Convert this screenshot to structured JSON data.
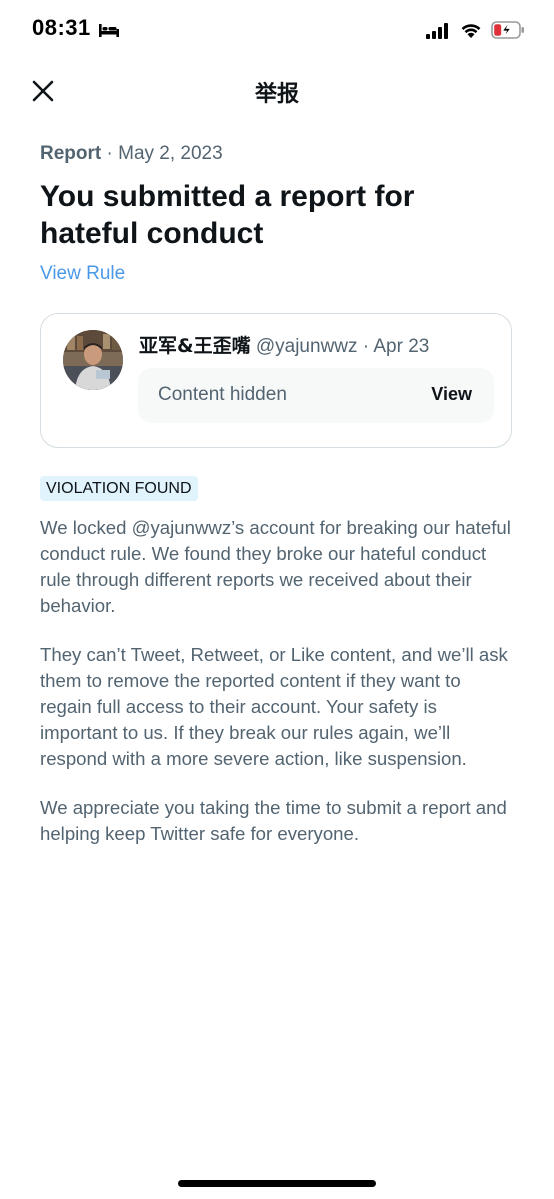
{
  "status_bar": {
    "time": "08:31",
    "icons": [
      "bed-icon",
      "cellular-signal-icon",
      "wifi-icon",
      "battery-charging-icon"
    ]
  },
  "header": {
    "title": "举报",
    "close_icon": "close-icon"
  },
  "report": {
    "label": "Report",
    "separator": " · ",
    "date": "May 2, 2023",
    "headline": "You submitted a report for hateful conduct",
    "view_rule": "View Rule"
  },
  "tweet": {
    "display_name": "亚军&王歪嘴",
    "handle_date": " @yajunwwz · Apr 23",
    "hidden_label": "Content hidden",
    "view_label": "View"
  },
  "violation": {
    "badge": "VIOLATION FOUND",
    "paragraphs": [
      "We locked @yajunwwz’s account for breaking our hateful conduct rule. We found they broke our hateful conduct rule through different reports we received about their behavior.",
      "They can’t Tweet, Retweet, or Like content, and we’ll ask them to remove the reported content if they want to regain full access to their account. Your safety is important to us. If they break our rules again, we’ll respond with a more severe action, like suspension.",
      "We appreciate you taking the time to submit a report and helping keep Twitter safe for everyone."
    ]
  },
  "colors": {
    "link": "#4a99e9",
    "badge_bg": "#e1f3fd",
    "secondary_text": "#536471",
    "primary_text": "#0f1419"
  }
}
